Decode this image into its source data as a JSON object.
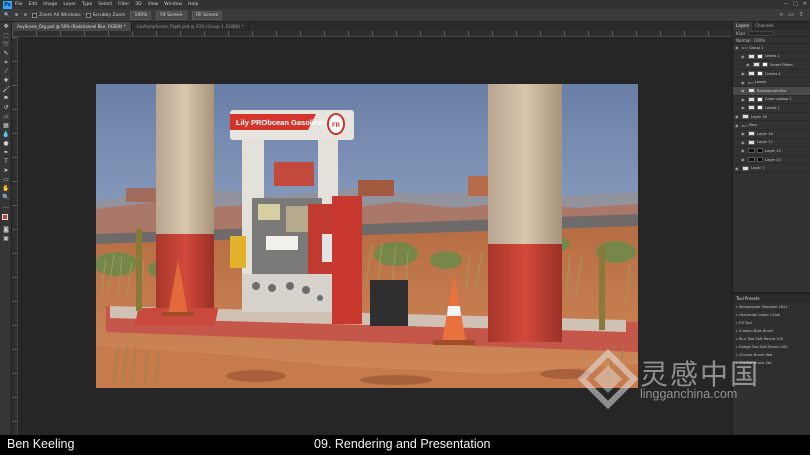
{
  "menubar": {
    "logo": "Ps",
    "items": [
      "File",
      "Edit",
      "Image",
      "Layer",
      "Type",
      "Select",
      "Filter",
      "3D",
      "View",
      "Window",
      "Help"
    ],
    "window_controls": [
      "—",
      "□",
      "✕"
    ]
  },
  "options_bar": {
    "zoom_all_windows": "Zoom All Windows",
    "scrubby_zoom": "Scrubby Zoom",
    "zoom_level": "100%",
    "fit_screen": "Fit Screen",
    "fill_screen": "Fill Screen"
  },
  "tabs": [
    {
      "label": "AnyScene_Org.psd @ 50% (Radchannel Blur, RGB/8) *",
      "active": true
    },
    {
      "label": "GasPumpScene_Flight.psd @ 33% (Group 1, RGB/8) *",
      "active": false
    }
  ],
  "render": {
    "gas_station_sign": "Lily PRObcean Gasolines",
    "oval_badge": "FR"
  },
  "panels": {
    "tabs": [
      "Layers",
      "Channels"
    ],
    "active_tab": "Layers",
    "filter": {
      "kind": "Kind",
      "mode": "Normal",
      "opacity": "100%"
    },
    "layers": [
      {
        "name": "Group 1",
        "type": "group",
        "indent": 0,
        "selected": false
      },
      {
        "name": "Levels 1",
        "type": "adj",
        "indent": 1,
        "selected": false
      },
      {
        "name": "Smart Filters",
        "type": "adj",
        "indent": 2,
        "selected": false
      },
      {
        "name": "Curves 1",
        "type": "adj",
        "indent": 1,
        "selected": false
      },
      {
        "name": "Levels",
        "type": "group",
        "indent": 1,
        "selected": false
      },
      {
        "name": "Radchannel Blur",
        "type": "image",
        "indent": 1,
        "selected": true
      },
      {
        "name": "Color Lookup 1",
        "type": "adj",
        "indent": 1,
        "selected": false
      },
      {
        "name": "Levels 1",
        "type": "adj",
        "indent": 1,
        "selected": false
      },
      {
        "name": "Layer 18",
        "type": "image",
        "indent": 0,
        "selected": false
      },
      {
        "name": "Pass",
        "type": "group",
        "indent": 0,
        "selected": false
      },
      {
        "name": "Layer 16",
        "type": "image",
        "indent": 1,
        "selected": false
      },
      {
        "name": "Layer 17",
        "type": "image",
        "indent": 1,
        "selected": false
      },
      {
        "name": "Layer 15",
        "type": "dark",
        "indent": 1,
        "selected": false
      },
      {
        "name": "Layer 14",
        "type": "dark",
        "indent": 1,
        "selected": false
      },
      {
        "name": "Layer 1",
        "type": "image",
        "indent": 0,
        "selected": false
      }
    ],
    "tool_presets_title": "Tool Presets",
    "tool_presets": [
      "Rectangular Marquee 16x1",
      "Horizontal Lasso 1 tool",
      "Fill Tool",
      "Custom Blob Brush",
      "Blur Tool Soft Round 100",
      "Dodge Tool Soft Round 200",
      "Circular Brush Red",
      "Circular Brush Sat"
    ]
  },
  "watermark": {
    "cn": "灵感中国",
    "en": "lingganchina.com"
  },
  "caption": {
    "author": "Ben Keeling",
    "chapter": "09. Rendering and Presentation"
  }
}
